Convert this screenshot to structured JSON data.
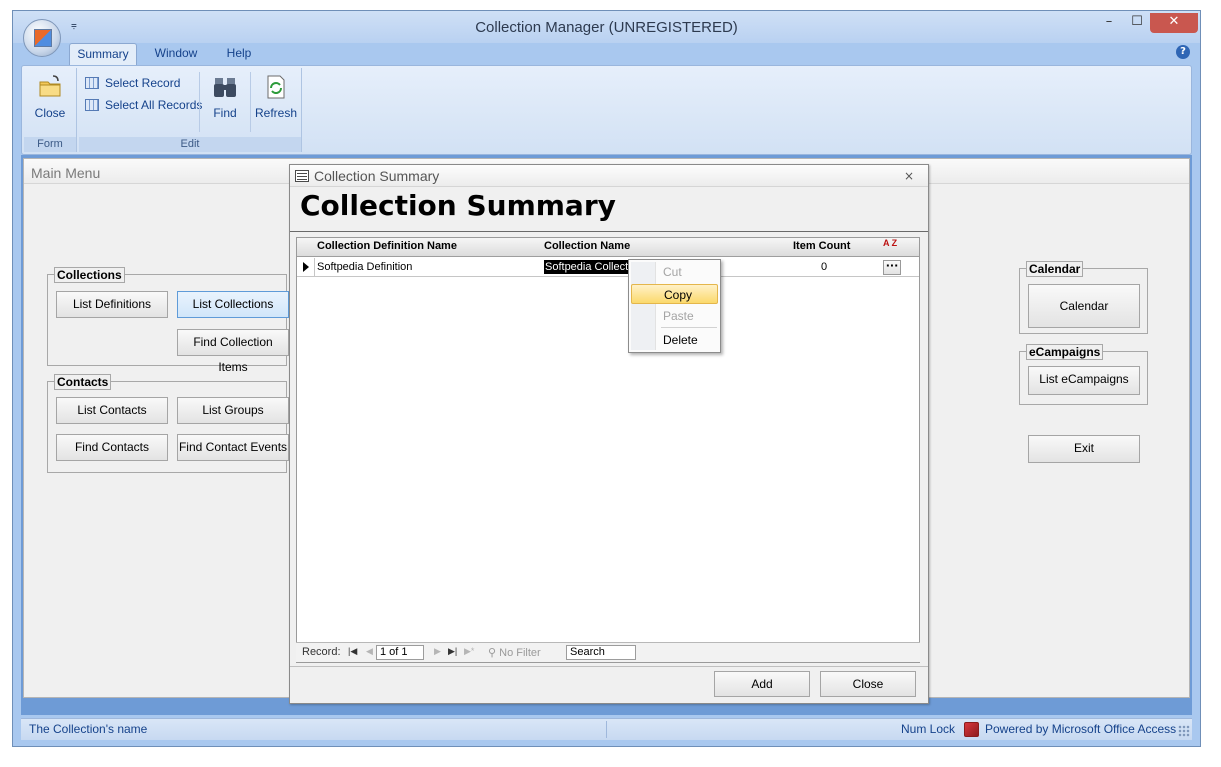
{
  "window": {
    "title": "Collection Manager (UNREGISTERED)",
    "qat": "⩦"
  },
  "ribbon": {
    "tabs": [
      "Summary",
      "Window",
      "Help"
    ],
    "groups": {
      "form": {
        "label": "Form",
        "close_label": "Close"
      },
      "edit": {
        "label": "Edit",
        "select_record": "Select Record",
        "select_all_records": "Select All Records",
        "find": "Find",
        "refresh": "Refresh"
      }
    }
  },
  "main_menu": {
    "title": "Main Menu",
    "collections": {
      "label": "Collections",
      "list_definitions": "List Definitions",
      "list_collections": "List Collections",
      "find_collection_items": "Find Collection Items"
    },
    "contacts": {
      "label": "Contacts",
      "list_contacts": "List Contacts",
      "list_groups": "List Groups",
      "find_contacts": "Find Contacts",
      "find_contact_events": "Find Contact Events"
    },
    "calendar": {
      "label": "Calendar",
      "button": "Calendar"
    },
    "ecampaigns": {
      "label": "eCampaigns",
      "button": "List eCampaigns"
    },
    "exit": "Exit"
  },
  "dialog": {
    "title": "Collection Summary",
    "heading": "Collection Summary",
    "columns": [
      "Collection Definition Name",
      "Collection Name",
      "Item Count"
    ],
    "sort_icon": "A Z",
    "rows": [
      {
        "definition": "Softpedia Definition",
        "name": "Softpedia Collection",
        "count": "0",
        "more": "···"
      }
    ],
    "nav": {
      "record_label": "Record:",
      "position": "1 of 1",
      "filter": "No Filter",
      "search": "Search"
    },
    "add_button": "Add",
    "close_button": "Close"
  },
  "context_menu": {
    "items": [
      "Cut",
      "Copy",
      "Paste",
      "Delete"
    ]
  },
  "status": {
    "message": "The Collection's name",
    "num_lock": "Num Lock",
    "powered_by": "Powered by Microsoft Office Access"
  },
  "colors": {
    "accent": "#15428b",
    "workspace": "#6e9bd6",
    "highlight": "#fbd96c"
  }
}
